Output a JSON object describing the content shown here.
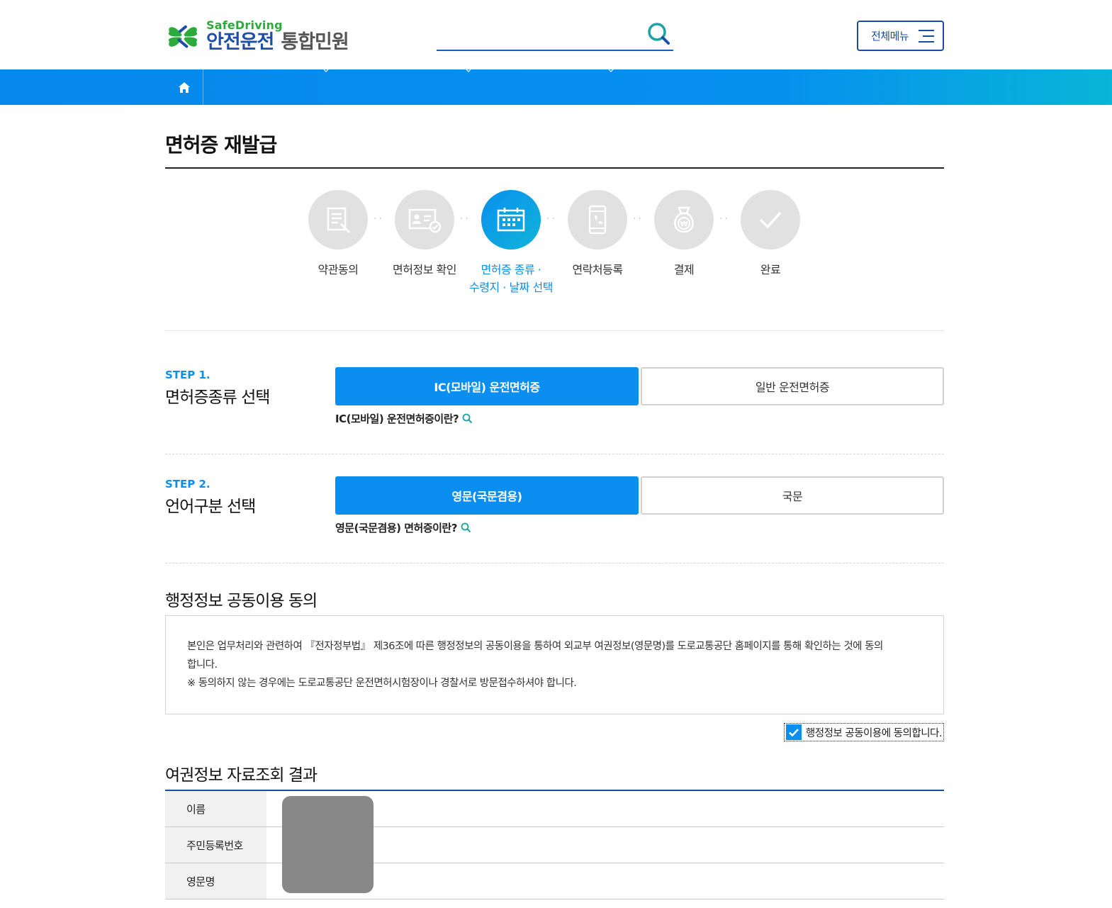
{
  "header": {
    "logo_sub": "SafeDriving",
    "logo_main": "안전운전",
    "logo_main2": "통합민원",
    "search_placeholder": "",
    "all_menu_label": "전체메뉴"
  },
  "page": {
    "title": "면허증 재발급"
  },
  "stepper": {
    "steps": [
      {
        "label": "약관동의",
        "icon": "document-pen-icon",
        "active": false
      },
      {
        "label": "면허정보 확인",
        "icon": "license-card-check-icon",
        "active": false
      },
      {
        "label": "면허증 종류 ·",
        "label2": "수령지 · 날짜 선택",
        "icon": "calendar-icon",
        "active": true
      },
      {
        "label": "연락처등록",
        "icon": "phone-icon",
        "active": false
      },
      {
        "label": "결제",
        "icon": "won-bag-icon",
        "active": false
      },
      {
        "label": "완료",
        "icon": "checkmark-icon",
        "active": false
      }
    ]
  },
  "step1": {
    "tag": "STEP 1.",
    "heading": "면허증종류 선택",
    "option_a": "IC(모바일) 운전면허증",
    "option_b": "일반 운전면허증",
    "selected": "IC(모바일) 운전면허증",
    "help": "IC(모바일) 운전면허증이란?"
  },
  "step2": {
    "tag": "STEP 2.",
    "heading": "언어구분 선택",
    "option_a": "영문(국문겸용)",
    "option_b": "국문",
    "selected": "영문(국문겸용)",
    "help": "영문(국문겸용) 면허증이란?"
  },
  "agreement": {
    "title": "행정정보 공동이용 동의",
    "line1": "본인은 업무처리와 관련하여 『전자정부법』 제36조에 따른 행정정보의 공동이용을 통하여 외교부 여권정보(영문명)를 도로교통공단 홈페이지를 통해 확인하는 것에 동의",
    "line2": "합니다.",
    "line3": "※ 동의하지 않는 경우에는 도로교통공단 운전면허시험장이나 경찰서로 방문접수하셔야 합니다.",
    "check_label": "행정정보 공동이용에 동의합니다.",
    "checked": true
  },
  "passport": {
    "title": "여권정보 자료조회 결과",
    "rows": [
      {
        "label": "이름"
      },
      {
        "label": "주민등록번호"
      },
      {
        "label": "영문명"
      }
    ]
  },
  "colors": {
    "accent": "#0a8ff0",
    "brand_navy": "#1b4e9a",
    "brand_green": "#2bab3b",
    "inactive_step": "#e1e1e1",
    "redaction": "#888888"
  }
}
